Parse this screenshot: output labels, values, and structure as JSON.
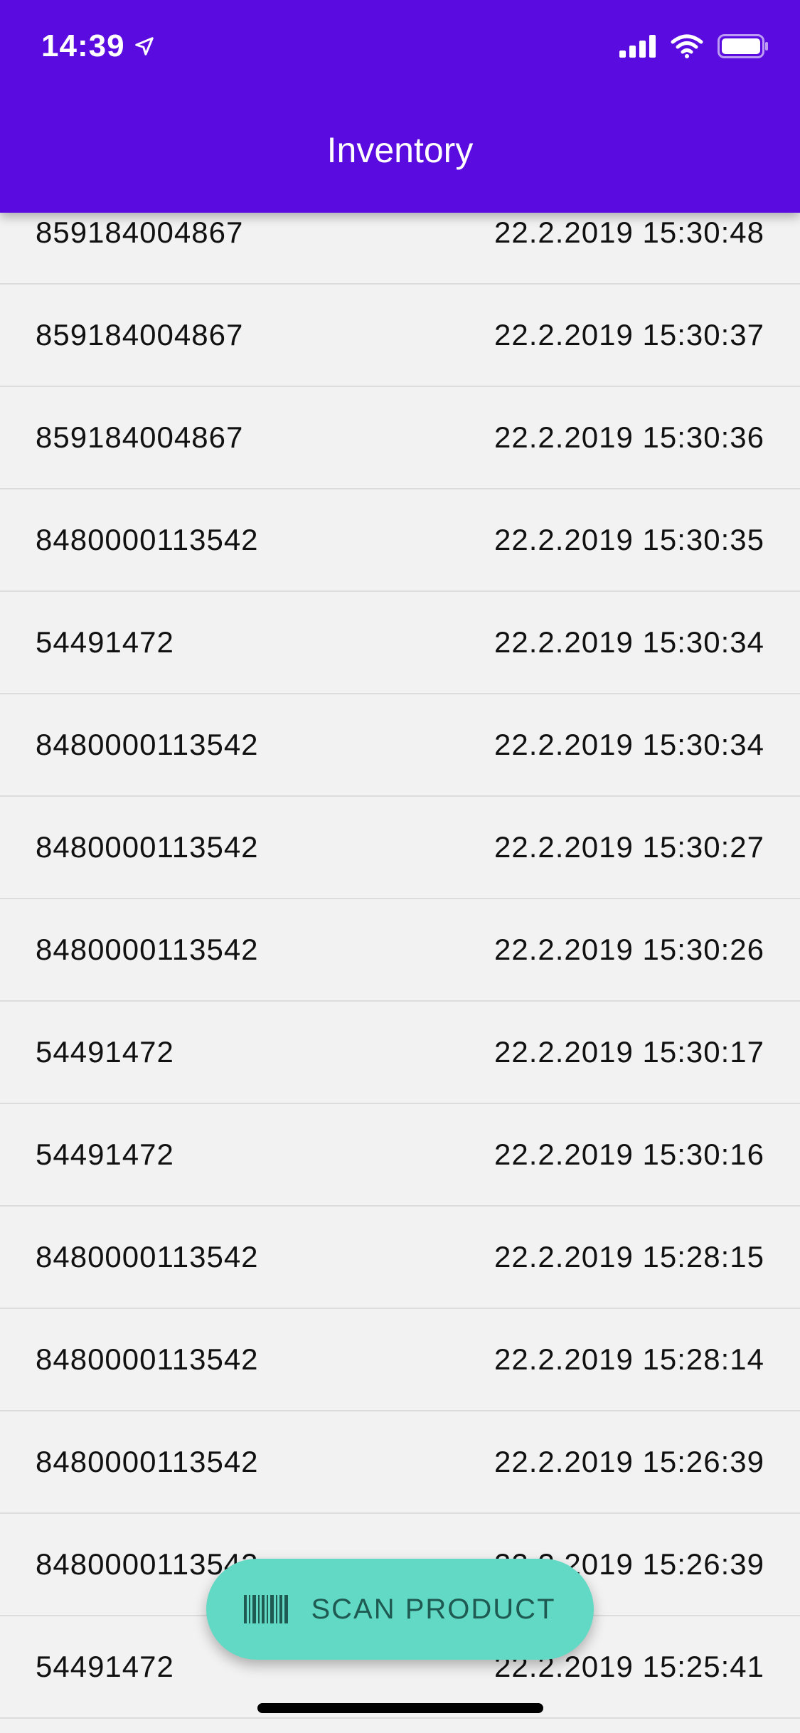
{
  "status_bar": {
    "time": "14:39",
    "icons": [
      "location-arrow-icon",
      "cellular-signal-icon",
      "wifi-icon",
      "battery-icon"
    ]
  },
  "header": {
    "title": "Inventory",
    "background_color": "#5a0ce0"
  },
  "list": {
    "items": [
      {
        "code": "859184004867",
        "timestamp": "22.2.2019 15:30:48"
      },
      {
        "code": "859184004867",
        "timestamp": "22.2.2019 15:30:37"
      },
      {
        "code": "859184004867",
        "timestamp": "22.2.2019 15:30:36"
      },
      {
        "code": "8480000113542",
        "timestamp": "22.2.2019 15:30:35"
      },
      {
        "code": "54491472",
        "timestamp": "22.2.2019 15:30:34"
      },
      {
        "code": "8480000113542",
        "timestamp": "22.2.2019 15:30:34"
      },
      {
        "code": "8480000113542",
        "timestamp": "22.2.2019 15:30:27"
      },
      {
        "code": "8480000113542",
        "timestamp": "22.2.2019 15:30:26"
      },
      {
        "code": "54491472",
        "timestamp": "22.2.2019 15:30:17"
      },
      {
        "code": "54491472",
        "timestamp": "22.2.2019 15:30:16"
      },
      {
        "code": "8480000113542",
        "timestamp": "22.2.2019 15:28:15"
      },
      {
        "code": "8480000113542",
        "timestamp": "22.2.2019 15:28:14"
      },
      {
        "code": "8480000113542",
        "timestamp": "22.2.2019 15:26:39"
      },
      {
        "code": "8480000113542",
        "timestamp": "22.2.2019 15:26:39"
      },
      {
        "code": "54491472",
        "timestamp": "22.2.2019 15:25:41"
      }
    ]
  },
  "fab": {
    "label": "SCAN PRODUCT",
    "icon": "barcode-icon",
    "background_color": "#62d9c4"
  }
}
